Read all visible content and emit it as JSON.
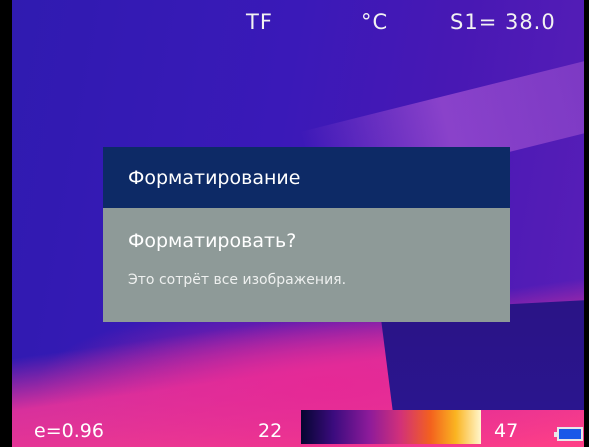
{
  "status_bar": {
    "storage": "TF",
    "unit": "°C",
    "spot_reading": "S1= 38.0"
  },
  "dialog": {
    "title": "Форматирование",
    "question": "Форматировать?",
    "message": "Это сотрёт все изображения."
  },
  "bottom_bar": {
    "emissivity": "e=0.96",
    "scale_min": "22",
    "scale_max": "47",
    "battery_icon": "battery-icon"
  },
  "colors": {
    "dialog_header": "#0d2a66",
    "dialog_body": "#8e9a98"
  }
}
